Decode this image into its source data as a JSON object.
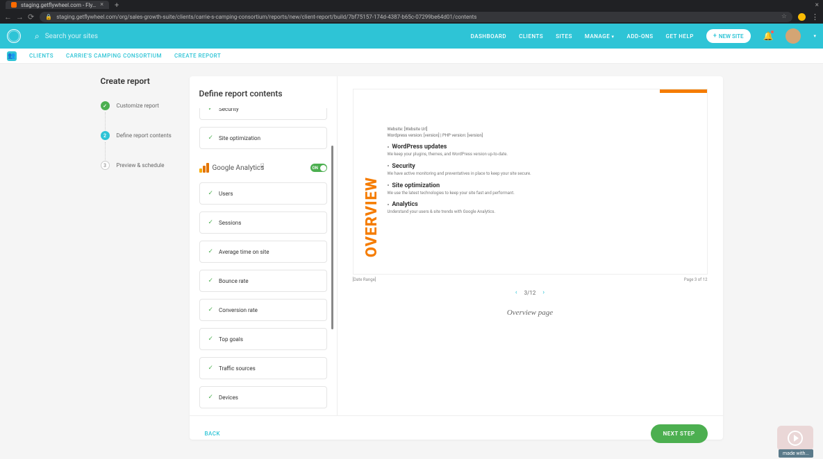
{
  "browser": {
    "tab_title": "staging.getflywheel.com - Fly…",
    "url": "staging.getflywheel.com/org/sales-growth-suite/clients/carrie-s-camping-consortium/reports/new/client-report/build/7bf75157-174d-4387-b65c-07299be64d01/contents"
  },
  "header": {
    "search_placeholder": "Search your sites",
    "nav": [
      "DASHBOARD",
      "CLIENTS",
      "SITES",
      "MANAGE",
      "ADD-ONS",
      "GET HELP"
    ],
    "new_site": "NEW SITE"
  },
  "breadcrumb": [
    "CLIENTS",
    "CARRIE'S CAMPING CONSORTIUM",
    "CREATE REPORT"
  ],
  "page_title": "Create report",
  "steps": [
    {
      "num": "✓",
      "label": "Customize report",
      "state": "done"
    },
    {
      "num": "2",
      "label": "Define report contents",
      "state": "active"
    },
    {
      "num": "3",
      "label": "Preview & schedule",
      "state": "pending"
    }
  ],
  "content_panel": {
    "title": "Define report contents",
    "top_options": [
      "Security",
      "Site optimization"
    ],
    "ga_section": {
      "label": "Google Analytics",
      "toggle": "ON",
      "options": [
        "Users",
        "Sessions",
        "Average time on site",
        "Bounce rate",
        "Conversion rate",
        "Top goals",
        "Traffic sources",
        "Devices"
      ]
    }
  },
  "preview": {
    "vertical_label": "OVERVIEW",
    "meta1": "Website: [Website Url]",
    "meta2": "Wordpress version: [version]  |  PHP version: [version]",
    "sections": [
      {
        "title": "WordPress updates",
        "desc": "We keep your plugins, themes, and WordPress version up-to-date."
      },
      {
        "title": "Security",
        "desc": "We have active monitoring and preventatives in place to keep your site secure."
      },
      {
        "title": "Site optimization",
        "desc": "We use the latest technologies to keep your site fast and performant."
      },
      {
        "title": "Analytics",
        "desc": "Understand your users & site trends with Google Analytics."
      }
    ],
    "footer_left": "[Date Range]",
    "footer_right": "Page 3 of 12",
    "pager": "3/12",
    "caption": "Overview page"
  },
  "footer": {
    "back": "BACK",
    "next": "NEXT STEP"
  },
  "made_with": "made with..."
}
